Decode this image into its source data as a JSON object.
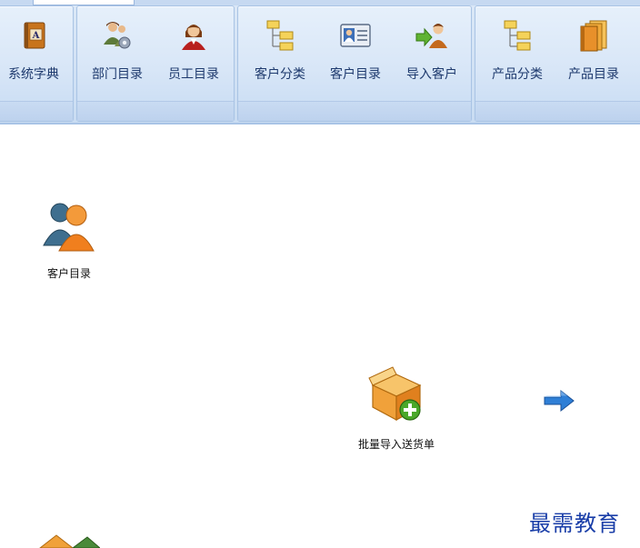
{
  "ribbon": {
    "groups": [
      {
        "buttons": [
          {
            "label": "系统字典",
            "icon": "dictionary-book-icon"
          }
        ]
      },
      {
        "buttons": [
          {
            "label": "部门目录",
            "icon": "department-settings-icon"
          },
          {
            "label": "员工目录",
            "icon": "employee-person-icon"
          }
        ]
      },
      {
        "buttons": [
          {
            "label": "客户分类",
            "icon": "tree-hierarchy-icon"
          },
          {
            "label": "客户目录",
            "icon": "contact-card-icon"
          },
          {
            "label": "导入客户",
            "icon": "import-person-icon"
          }
        ]
      },
      {
        "buttons": [
          {
            "label": "产品分类",
            "icon": "tree-hierarchy-icon"
          },
          {
            "label": "产品目录",
            "icon": "product-books-icon"
          }
        ]
      }
    ]
  },
  "workspace": {
    "customer_directory": {
      "label": "客户目录",
      "icon": "customers-people-icon"
    },
    "batch_import": {
      "label": "批量导入送货单",
      "icon": "box-add-icon"
    },
    "arrow": {
      "icon": "arrow-right-icon"
    }
  },
  "watermark": "最需教育",
  "colors": {
    "ribbon_bg": "#d8e6f7",
    "label_text": "#1e3a6e",
    "watermark": "#1a3ea8"
  }
}
